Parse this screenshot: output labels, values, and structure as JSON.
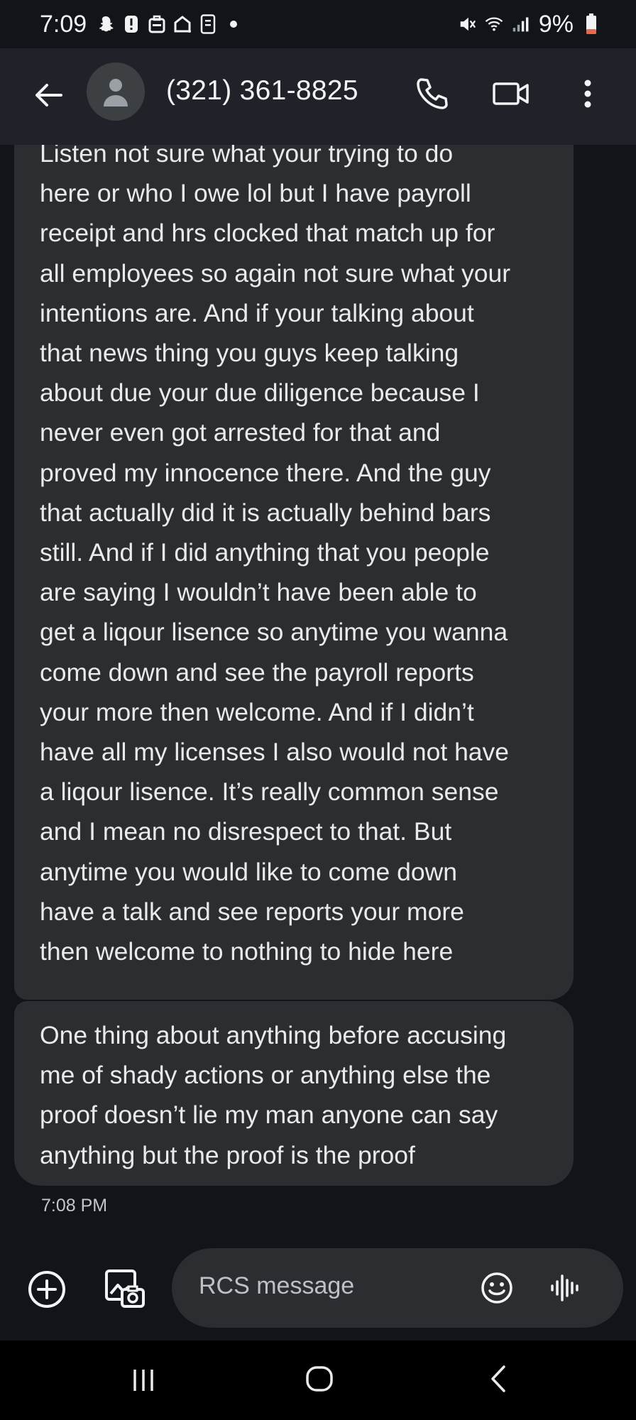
{
  "status_bar": {
    "time": "7:09",
    "battery_percent": "9%",
    "left_icons": [
      "snapchat-icon",
      "alert-icon",
      "briefcase-icon",
      "home-icon",
      "screenshot-icon",
      "dot-icon"
    ],
    "right_icons": [
      "mute-icon",
      "wifi-icon",
      "signal-icon",
      "battery-low-icon"
    ]
  },
  "app_bar": {
    "contact_name": "(321) 361-8825",
    "icons": [
      "back-arrow-icon",
      "person-icon",
      "phone-icon",
      "video-icon",
      "more-vert-icon"
    ]
  },
  "messages": [
    {
      "text": "Listen not sure what your trying to do here or who I owe lol but I have payroll receipt and hrs clocked that match up for all employees so again not sure what your intentions are. And if your talking about that news thing you guys keep talking about due your due diligence because I never even got arrested for that and proved my innocence there. And the guy that actually did it is actually behind bars still. And if I did anything that you people are saying I wouldn’t have been able to get a liqour lisence so anytime you wanna come down and see the payroll reports your more then welcome. And if I didn’t have all my licenses I also would not have a liqour lisence. It’s really common sense and I mean no disrespect to that. But anytime you would like to come down have a talk and see reports your more then welcome to nothing to hide here",
      "lines": [
        "Listen not sure what your trying to do",
        "here or who I owe lol but I have payroll",
        "receipt and hrs clocked that match up for",
        "all employees so again not sure what your",
        "intentions are. And if your talking about",
        "that news thing you guys keep talking",
        "about due your due diligence because I",
        "never even got arrested for that and",
        "proved my innocence there. And the guy",
        "that actually did it is actually behind bars",
        "still. And if I did anything that you people",
        "are saying I wouldn’t have been able to",
        "get a liqour lisence so anytime you wanna",
        "come down and see the payroll reports",
        "your more then welcome. And if I didn’t",
        "have all my licenses I also would not have",
        "a liqour lisence. It’s really common sense",
        "and I mean no disrespect to that. But",
        "anytime you would like to come down",
        "have a talk and see reports your more",
        "then welcome to nothing to hide here"
      ]
    },
    {
      "text": "One thing about anything before accusing me of shady actions or anything else the proof doesn’t lie my man anyone can say anything but the proof is the proof",
      "lines": [
        "One thing about anything before accusing",
        "me of shady actions or anything else the",
        "proof doesn’t lie my man anyone can say",
        "anything but the proof is the proof"
      ]
    }
  ],
  "timestamp": "7:08 PM",
  "compose": {
    "placeholder": "RCS message",
    "icons": [
      "add-circle-icon",
      "gallery-icon",
      "emoji-icon",
      "voice-waveform-icon"
    ]
  },
  "nav_bar": {
    "icons": [
      "recents-icon",
      "home-button-icon",
      "back-chevron-icon"
    ]
  },
  "colors": {
    "background": "#111418",
    "app_bar": "#1f2329",
    "bubble": "#2c2d30",
    "text": "#e8eaed",
    "battery_low": "#e8684a"
  }
}
